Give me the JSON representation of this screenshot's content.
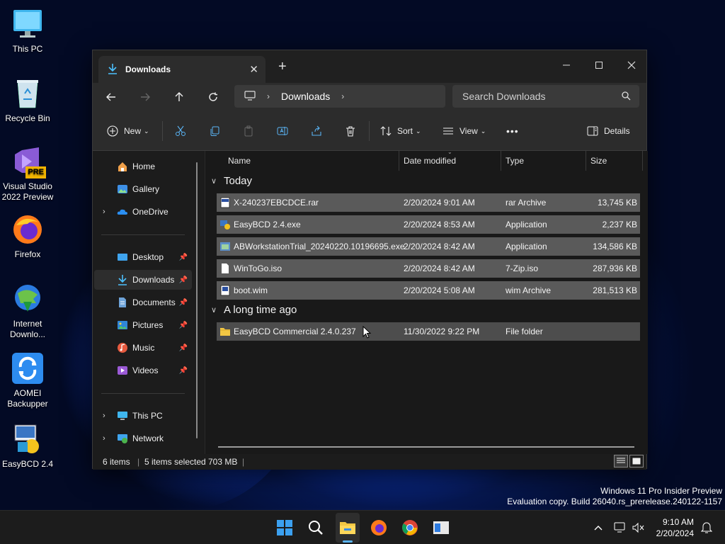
{
  "desktop": {
    "icons": [
      {
        "label": "This PC",
        "icon": "monitor-icon"
      },
      {
        "label": "Recycle Bin",
        "icon": "recycle-bin-icon"
      },
      {
        "label": "Visual Studio 2022 Preview",
        "badge": "PRE",
        "icon": "visual-studio-icon"
      },
      {
        "label": "Firefox",
        "icon": "firefox-icon"
      },
      {
        "label": "Internet Downlo...",
        "icon": "internet-download-manager-icon"
      },
      {
        "label": "AOMEI Backupper",
        "icon": "aomei-backupper-icon"
      },
      {
        "label": "EasyBCD 2.4",
        "icon": "easybcd-icon"
      }
    ],
    "watermark_line1": "Windows 11 Pro Insider Preview",
    "watermark_line2": "Evaluation copy. Build 26040.rs_prerelease.240122-1157"
  },
  "explorer": {
    "tab_title": "Downloads",
    "breadcrumb": {
      "location": "Downloads"
    },
    "search_placeholder": "Search Downloads",
    "commands": {
      "new": "New",
      "sort": "Sort",
      "view": "View",
      "more": "•••",
      "details": "Details"
    },
    "sidebar": {
      "top": [
        {
          "label": "Home",
          "icon": "home-icon"
        },
        {
          "label": "Gallery",
          "icon": "gallery-icon"
        },
        {
          "label": "OneDrive",
          "icon": "onedrive-icon"
        }
      ],
      "pinned": [
        {
          "label": "Desktop",
          "icon": "desktop-folder-icon"
        },
        {
          "label": "Downloads",
          "icon": "downloads-icon",
          "selected": true
        },
        {
          "label": "Documents",
          "icon": "documents-icon"
        },
        {
          "label": "Pictures",
          "icon": "pictures-icon"
        },
        {
          "label": "Music",
          "icon": "music-icon"
        },
        {
          "label": "Videos",
          "icon": "videos-icon"
        }
      ],
      "bottom": [
        {
          "label": "This PC",
          "icon": "this-pc-icon"
        },
        {
          "label": "Network",
          "icon": "network-icon"
        }
      ]
    },
    "columns": {
      "name": "Name",
      "date": "Date modified",
      "type": "Type",
      "size": "Size"
    },
    "groups": [
      {
        "title": "Today",
        "files": [
          {
            "name": "X-240237EBCDCE.rar",
            "date": "2/20/2024 9:01 AM",
            "type": "rar Archive",
            "size": "13,745 KB",
            "icon": "rar-archive-icon",
            "selected": true
          },
          {
            "name": "EasyBCD 2.4.exe",
            "date": "2/20/2024 8:53 AM",
            "type": "Application",
            "size": "2,237 KB",
            "icon": "easybcd-app-icon",
            "selected": true
          },
          {
            "name": "ABWorkstationTrial_20240220.10196695.exe",
            "date": "2/20/2024 8:42 AM",
            "type": "Application",
            "size": "134,586 KB",
            "icon": "application-icon",
            "selected": true
          },
          {
            "name": "WinToGo.iso",
            "date": "2/20/2024 8:42 AM",
            "type": "7-Zip.iso",
            "size": "287,936 KB",
            "icon": "blank-file-icon",
            "selected": true
          },
          {
            "name": "boot.wim",
            "date": "2/20/2024 5:08 AM",
            "type": "wim Archive",
            "size": "281,513 KB",
            "icon": "wim-archive-icon",
            "selected": true
          }
        ]
      },
      {
        "title": "A long time ago",
        "files": [
          {
            "name": "EasyBCD Commercial 2.4.0.237",
            "date": "11/30/2022 9:22 PM",
            "type": "File folder",
            "size": "",
            "icon": "folder-icon",
            "selected": false
          }
        ]
      }
    ],
    "status": {
      "items": "6 items",
      "selected": "5 items selected",
      "selected_size": "703 MB"
    }
  },
  "taskbar": {
    "time": "9:10 AM",
    "date": "2/20/2024"
  },
  "colors": {
    "accent": "#5ab4f5",
    "selection": "#5a5a5a",
    "window_bg": "#1c1c1c",
    "folder": "#f2c744"
  }
}
